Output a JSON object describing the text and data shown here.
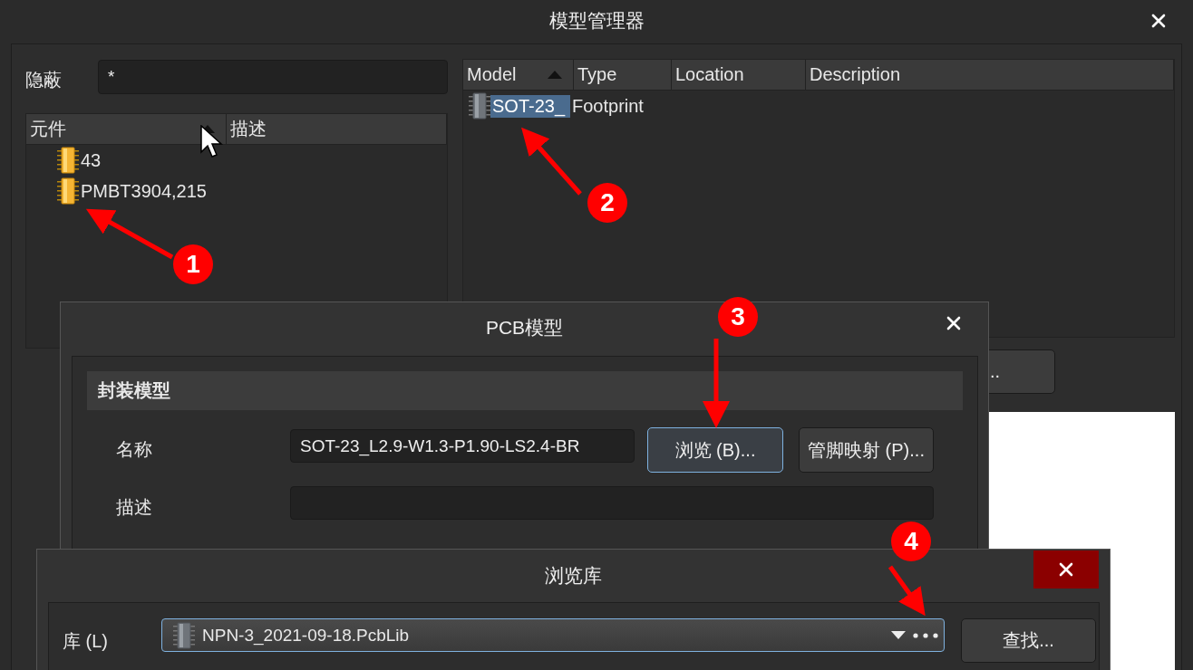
{
  "main_window": {
    "title": "模型管理器"
  },
  "filter": {
    "label": "隐蔽",
    "value": "*"
  },
  "components": {
    "columns": [
      {
        "label": "元件",
        "sorted": true
      },
      {
        "label": "描述",
        "sorted": false
      }
    ],
    "rows": [
      {
        "name": "43",
        "selected": false
      },
      {
        "name": "PMBT3904,215",
        "selected": false
      }
    ]
  },
  "models": {
    "columns": [
      {
        "label": "Model",
        "sorted": true
      },
      {
        "label": "Type",
        "sorted": false
      },
      {
        "label": "Location",
        "sorted": false
      },
      {
        "label": "Description",
        "sorted": false
      }
    ],
    "rows": [
      {
        "model": "SOT-23_",
        "type": "Footprint",
        "selected": true
      }
    ]
  },
  "partial_button": {
    "label": ".."
  },
  "pcb_dialog": {
    "title": "PCB模型",
    "section": "封装模型",
    "name_label": "名称",
    "name_value": "SOT-23_L2.9-W1.3-P1.90-LS2.4-BR",
    "browse_button": {
      "label": "浏览 (B)...",
      "focused": true
    },
    "pin_map_button": {
      "label": "管脚映射 (P)...",
      "focused": false
    },
    "desc_label": "描述"
  },
  "browse_dialog": {
    "title": "浏览库",
    "library_label": "库 (L)",
    "library_value": "NPN-3_2021-09-18.PcbLib",
    "find_button": "查找..."
  },
  "annotations": [
    {
      "number": "1"
    },
    {
      "number": "2"
    },
    {
      "number": "3"
    },
    {
      "number": "4"
    }
  ]
}
